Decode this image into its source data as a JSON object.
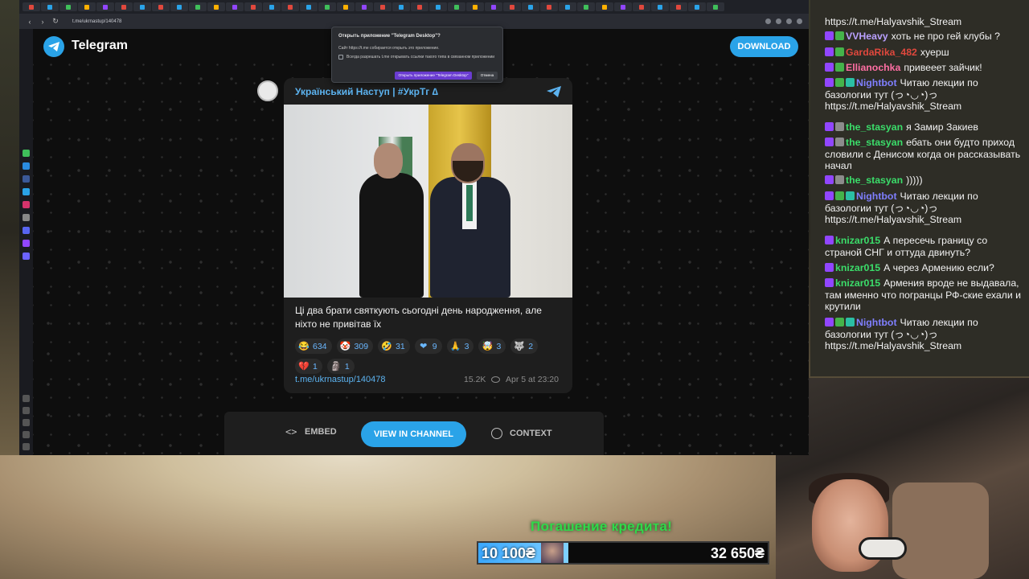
{
  "browser": {
    "url": "t.me/ukrnastup/140478"
  },
  "telegram": {
    "brand": "Telegram",
    "download_label": "DOWNLOAD",
    "post": {
      "channel_title": "Український Наступ | #УкрТг ∆",
      "text": "Ці два брати святкують сьогодні день народження, але ніхто не привітав їх",
      "reactions": [
        {
          "emoji": "😂",
          "count": "634"
        },
        {
          "emoji": "🤡",
          "count": "309"
        },
        {
          "emoji": "🤣",
          "count": "31"
        },
        {
          "emoji": "❤",
          "count": "9"
        },
        {
          "emoji": "🙏",
          "count": "3"
        },
        {
          "emoji": "🤯",
          "count": "3"
        },
        {
          "emoji": "🐺",
          "count": "2"
        },
        {
          "emoji": "💔",
          "count": "1"
        },
        {
          "emoji": "🗿",
          "count": "1"
        }
      ],
      "link": "t.me/ukrnastup/140478",
      "views": "15.2K",
      "date": "Apr 5 at 23:20"
    },
    "bottom_bar": {
      "embed_label": "EMBED",
      "view_channel_label": "VIEW IN CHANNEL",
      "context_label": "CONTEXT"
    }
  },
  "dialog": {
    "title": "Открыть приложение \"Telegram Desktop\"?",
    "message": "Сайт https://t.me собирается открыть это приложение.",
    "checkbox_label": "Всегда разрешать t.me открывать ссылки такого типа в связанном приложении",
    "open_label": "Открыть приложение \"Telegram Desktop\"",
    "cancel_label": "Отмена"
  },
  "chat": {
    "messages": [
      {
        "user": "",
        "color": "#f2f2f2",
        "text": "https://t.me/Halyavshik_Stream",
        "badges": []
      },
      {
        "user": "VVHeavy",
        "color": "#b9a0ff",
        "text": "хоть не про гей клубы ?",
        "badges": [
          "purple",
          "green"
        ]
      },
      {
        "user": "GardaRika_482",
        "color": "#e0483d",
        "text": "хуерш",
        "badges": [
          "purple",
          "green"
        ]
      },
      {
        "user": "Ellianochka",
        "color": "#ff6fa3",
        "text": "привееет зайчик!",
        "badges": [
          "purple",
          "green"
        ]
      },
      {
        "user": "Nightbot",
        "color": "#7f7fff",
        "text": "Читаю лекции по базологии тут (っ◔◡◔)っ https://t.me/Halyavshik_Stream",
        "badges": [
          "purple",
          "green",
          "teal"
        ]
      },
      {
        "user": "the_stasyan",
        "color": "#3bdd6a",
        "text": "я Замир Закиев",
        "badges": [
          "purple",
          "gray"
        ]
      },
      {
        "user": "the_stasyan",
        "color": "#3bdd6a",
        "text": "ебать они будто приход словили с Денисом когда он рассказывать начал",
        "badges": [
          "purple",
          "gray"
        ]
      },
      {
        "user": "the_stasyan",
        "color": "#3bdd6a",
        "text": ")))))",
        "badges": [
          "purple",
          "gray"
        ]
      },
      {
        "user": "Nightbot",
        "color": "#7f7fff",
        "text": "Читаю лекции по базологии тут (っ◔◡◔)っ https://t.me/Halyavshik_Stream",
        "badges": [
          "purple",
          "green",
          "teal"
        ]
      },
      {
        "user": "knizar015",
        "color": "#3bdd6a",
        "text": "А пересечь границу со страной СНГ и оттуда двинуть?",
        "badges": [
          "purple"
        ]
      },
      {
        "user": "knizar015",
        "color": "#3bdd6a",
        "text": "А через Армению если?",
        "badges": [
          "purple"
        ]
      },
      {
        "user": "knizar015",
        "color": "#3bdd6a",
        "text": "Армения вроде не выдавала, там именно что погранцы РФ-ские ехали и крутили",
        "badges": [
          "purple"
        ]
      },
      {
        "user": "Nightbot",
        "color": "#7f7fff",
        "text": "Читаю лекции по базологии тут (っ◔◡◔)っ https://t.me/Halyavshik_Stream",
        "badges": [
          "purple",
          "green",
          "teal"
        ]
      }
    ]
  },
  "credit": {
    "title": "Погашение кредита!",
    "current": "10 100₴",
    "goal": "32 650₴",
    "progress": 0.31
  }
}
